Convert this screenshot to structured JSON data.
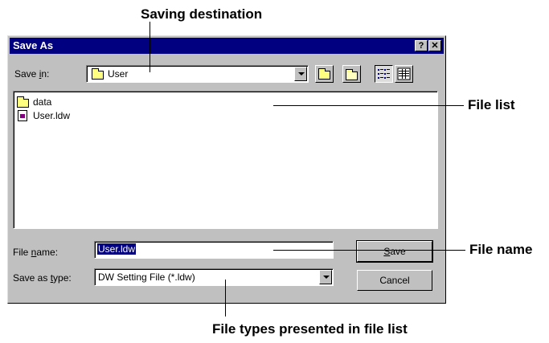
{
  "callouts": {
    "saving_destination": "Saving destination",
    "file_list": "File list",
    "file_name": "File name",
    "file_types": "File types presented in file list"
  },
  "dialog": {
    "title": "Save As",
    "help_button": "?",
    "close_button": "✕",
    "save_in_label_pre": "Save ",
    "save_in_label_u": "i",
    "save_in_label_post": "n:",
    "save_in_value": "User",
    "files": [
      {
        "name": "data",
        "icon": "folder-icon"
      },
      {
        "name": "User.ldw",
        "icon": "ldw-file-icon"
      }
    ],
    "file_name_label_pre": "File ",
    "file_name_label_u": "n",
    "file_name_label_post": "ame:",
    "file_name_value": "User.ldw",
    "save_type_label_pre": "Save as ",
    "save_type_label_u": "t",
    "save_type_label_post": "ype:",
    "save_type_value": "DW Setting File (*.ldw)",
    "save_button_u": "S",
    "save_button_rest": "ave",
    "cancel_button": "Cancel"
  },
  "colors": {
    "titlebar": "#000080",
    "dialog_face": "#c0c0c0",
    "selection": "#000080"
  }
}
